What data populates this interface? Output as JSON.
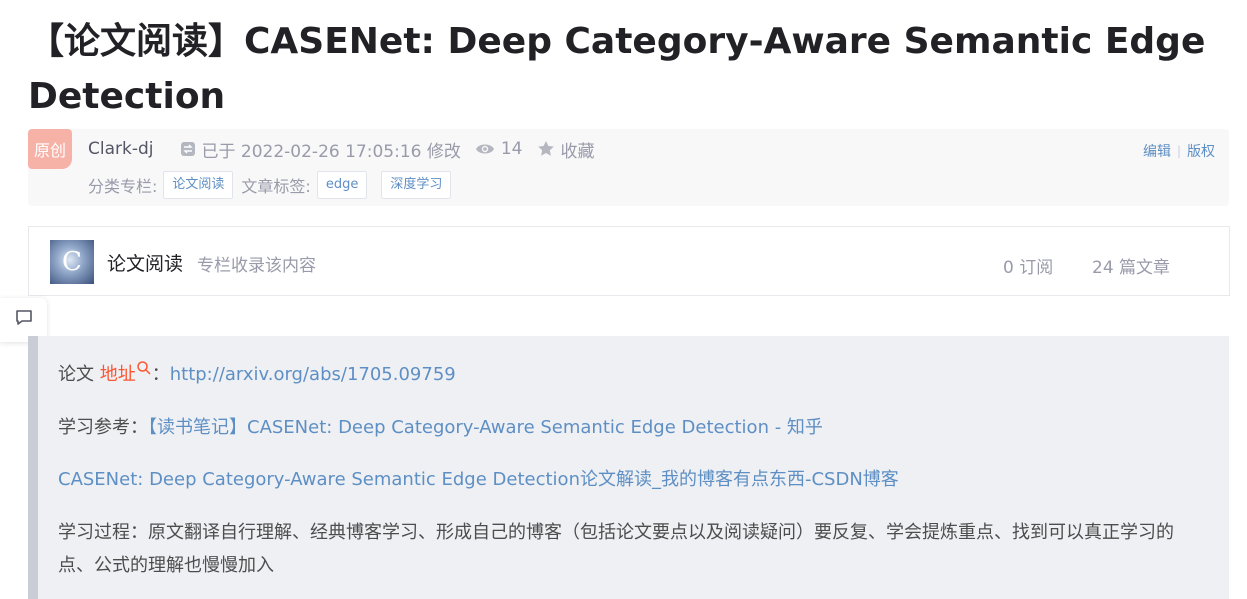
{
  "article": {
    "title": "【论文阅读】CASENet: Deep Category-Aware Semantic Edge Detection"
  },
  "meta": {
    "original_badge": "原创",
    "author": "Clark-dj",
    "date": "已于 2022-02-26 17:05:16 修改",
    "views": "14",
    "collect": "收藏",
    "edit_link": "编辑",
    "copyright_link": "版权",
    "category_label": "分类专栏:",
    "category": "论文阅读",
    "tags_label": "文章标签:",
    "tags": [
      "edge",
      "深度学习"
    ]
  },
  "column": {
    "thumb_letter": "C",
    "name": "论文阅读",
    "desc": "专栏收录该内容",
    "subscriptions": "0 订阅",
    "articles": "24 篇文章"
  },
  "content": {
    "line1_prefix": "论文 ",
    "line1_keyword": "地址",
    "line1_colon": "：",
    "line1_url": "http://arxiv.org/abs/1705.09759",
    "line2_prefix": "学习参考：",
    "line2_link": "【读书笔记】CASENet: Deep Category-Aware Semantic Edge Detection - 知乎",
    "line3_link": "CASENet: Deep Category-Aware Semantic Edge Detection论文解读_我的博客有点东西-CSDN博客",
    "line4": "学习过程：原文翻译自行理解、经典博客学习、形成自己的博客（包括论文要点以及阅读疑问）要反复、学会提炼重点、找到可以真正学习的点、公式的理解也慢慢加入"
  },
  "colors": {
    "link": "#5e8fc4",
    "keyword_red": "#fc5531",
    "badge_bg": "#f7b2a8",
    "quote_bg": "#eef0f4"
  }
}
